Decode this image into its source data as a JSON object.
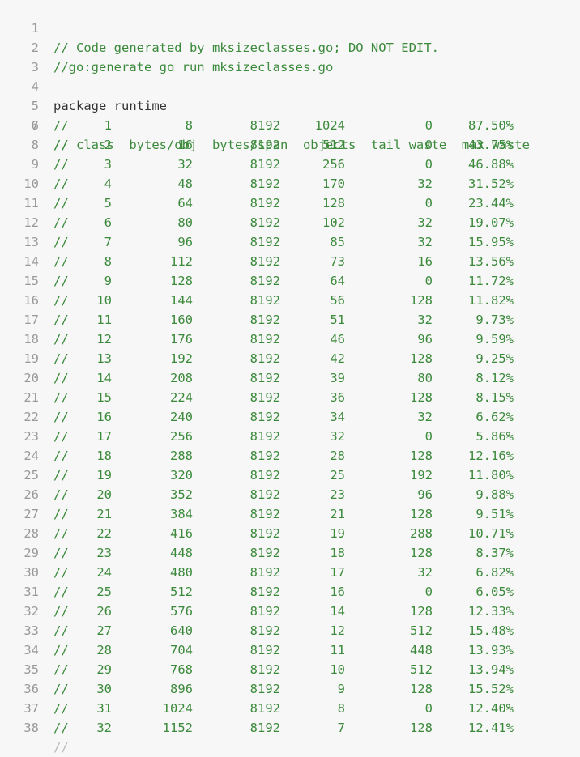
{
  "header_lines": [
    {
      "num": "1",
      "text": "// Code generated by mksizeclasses.go; DO NOT EDIT.",
      "kind": "comment"
    },
    {
      "num": "2",
      "text": "//go:generate go run mksizeclasses.go",
      "kind": "comment"
    },
    {
      "num": "3",
      "text": "",
      "kind": "plain"
    },
    {
      "num": "4",
      "text": "package runtime",
      "kind": "plain"
    },
    {
      "num": "5",
      "text": "",
      "kind": "plain"
    }
  ],
  "table_header": {
    "num": "6",
    "text": "// class  bytes/obj  bytes/span  objects  tail waste  max waste"
  },
  "comment_marker": "//",
  "rows": [
    {
      "num": "7",
      "class": "1",
      "bytes_obj": "8",
      "bytes_span": "8192",
      "objects": "1024",
      "tail_waste": "0",
      "max_waste": "87.50%"
    },
    {
      "num": "8",
      "class": "2",
      "bytes_obj": "16",
      "bytes_span": "8192",
      "objects": "512",
      "tail_waste": "0",
      "max_waste": "43.75%"
    },
    {
      "num": "9",
      "class": "3",
      "bytes_obj": "32",
      "bytes_span": "8192",
      "objects": "256",
      "tail_waste": "0",
      "max_waste": "46.88%"
    },
    {
      "num": "10",
      "class": "4",
      "bytes_obj": "48",
      "bytes_span": "8192",
      "objects": "170",
      "tail_waste": "32",
      "max_waste": "31.52%"
    },
    {
      "num": "11",
      "class": "5",
      "bytes_obj": "64",
      "bytes_span": "8192",
      "objects": "128",
      "tail_waste": "0",
      "max_waste": "23.44%"
    },
    {
      "num": "12",
      "class": "6",
      "bytes_obj": "80",
      "bytes_span": "8192",
      "objects": "102",
      "tail_waste": "32",
      "max_waste": "19.07%"
    },
    {
      "num": "13",
      "class": "7",
      "bytes_obj": "96",
      "bytes_span": "8192",
      "objects": "85",
      "tail_waste": "32",
      "max_waste": "15.95%"
    },
    {
      "num": "14",
      "class": "8",
      "bytes_obj": "112",
      "bytes_span": "8192",
      "objects": "73",
      "tail_waste": "16",
      "max_waste": "13.56%"
    },
    {
      "num": "15",
      "class": "9",
      "bytes_obj": "128",
      "bytes_span": "8192",
      "objects": "64",
      "tail_waste": "0",
      "max_waste": "11.72%"
    },
    {
      "num": "16",
      "class": "10",
      "bytes_obj": "144",
      "bytes_span": "8192",
      "objects": "56",
      "tail_waste": "128",
      "max_waste": "11.82%"
    },
    {
      "num": "17",
      "class": "11",
      "bytes_obj": "160",
      "bytes_span": "8192",
      "objects": "51",
      "tail_waste": "32",
      "max_waste": "9.73%"
    },
    {
      "num": "18",
      "class": "12",
      "bytes_obj": "176",
      "bytes_span": "8192",
      "objects": "46",
      "tail_waste": "96",
      "max_waste": "9.59%"
    },
    {
      "num": "19",
      "class": "13",
      "bytes_obj": "192",
      "bytes_span": "8192",
      "objects": "42",
      "tail_waste": "128",
      "max_waste": "9.25%"
    },
    {
      "num": "20",
      "class": "14",
      "bytes_obj": "208",
      "bytes_span": "8192",
      "objects": "39",
      "tail_waste": "80",
      "max_waste": "8.12%"
    },
    {
      "num": "21",
      "class": "15",
      "bytes_obj": "224",
      "bytes_span": "8192",
      "objects": "36",
      "tail_waste": "128",
      "max_waste": "8.15%"
    },
    {
      "num": "22",
      "class": "16",
      "bytes_obj": "240",
      "bytes_span": "8192",
      "objects": "34",
      "tail_waste": "32",
      "max_waste": "6.62%"
    },
    {
      "num": "23",
      "class": "17",
      "bytes_obj": "256",
      "bytes_span": "8192",
      "objects": "32",
      "tail_waste": "0",
      "max_waste": "5.86%"
    },
    {
      "num": "24",
      "class": "18",
      "bytes_obj": "288",
      "bytes_span": "8192",
      "objects": "28",
      "tail_waste": "128",
      "max_waste": "12.16%"
    },
    {
      "num": "25",
      "class": "19",
      "bytes_obj": "320",
      "bytes_span": "8192",
      "objects": "25",
      "tail_waste": "192",
      "max_waste": "11.80%"
    },
    {
      "num": "26",
      "class": "20",
      "bytes_obj": "352",
      "bytes_span": "8192",
      "objects": "23",
      "tail_waste": "96",
      "max_waste": "9.88%"
    },
    {
      "num": "27",
      "class": "21",
      "bytes_obj": "384",
      "bytes_span": "8192",
      "objects": "21",
      "tail_waste": "128",
      "max_waste": "9.51%"
    },
    {
      "num": "28",
      "class": "22",
      "bytes_obj": "416",
      "bytes_span": "8192",
      "objects": "19",
      "tail_waste": "288",
      "max_waste": "10.71%"
    },
    {
      "num": "29",
      "class": "23",
      "bytes_obj": "448",
      "bytes_span": "8192",
      "objects": "18",
      "tail_waste": "128",
      "max_waste": "8.37%"
    },
    {
      "num": "30",
      "class": "24",
      "bytes_obj": "480",
      "bytes_span": "8192",
      "objects": "17",
      "tail_waste": "32",
      "max_waste": "6.82%"
    },
    {
      "num": "31",
      "class": "25",
      "bytes_obj": "512",
      "bytes_span": "8192",
      "objects": "16",
      "tail_waste": "0",
      "max_waste": "6.05%"
    },
    {
      "num": "32",
      "class": "26",
      "bytes_obj": "576",
      "bytes_span": "8192",
      "objects": "14",
      "tail_waste": "128",
      "max_waste": "12.33%"
    },
    {
      "num": "33",
      "class": "27",
      "bytes_obj": "640",
      "bytes_span": "8192",
      "objects": "12",
      "tail_waste": "512",
      "max_waste": "15.48%"
    },
    {
      "num": "34",
      "class": "28",
      "bytes_obj": "704",
      "bytes_span": "8192",
      "objects": "11",
      "tail_waste": "448",
      "max_waste": "13.93%"
    },
    {
      "num": "35",
      "class": "29",
      "bytes_obj": "768",
      "bytes_span": "8192",
      "objects": "10",
      "tail_waste": "512",
      "max_waste": "13.94%"
    },
    {
      "num": "36",
      "class": "30",
      "bytes_obj": "896",
      "bytes_span": "8192",
      "objects": "9",
      "tail_waste": "128",
      "max_waste": "15.52%"
    },
    {
      "num": "37",
      "class": "31",
      "bytes_obj": "1024",
      "bytes_span": "8192",
      "objects": "8",
      "tail_waste": "0",
      "max_waste": "12.40%"
    },
    {
      "num": "38",
      "class": "32",
      "bytes_obj": "1152",
      "bytes_span": "8192",
      "objects": "7",
      "tail_waste": "128",
      "max_waste": "12.41%"
    }
  ],
  "colors": {
    "background": "#f7f7f7",
    "line_number": "#999999",
    "comment": "#3b8a3b",
    "plain": "#333333"
  }
}
